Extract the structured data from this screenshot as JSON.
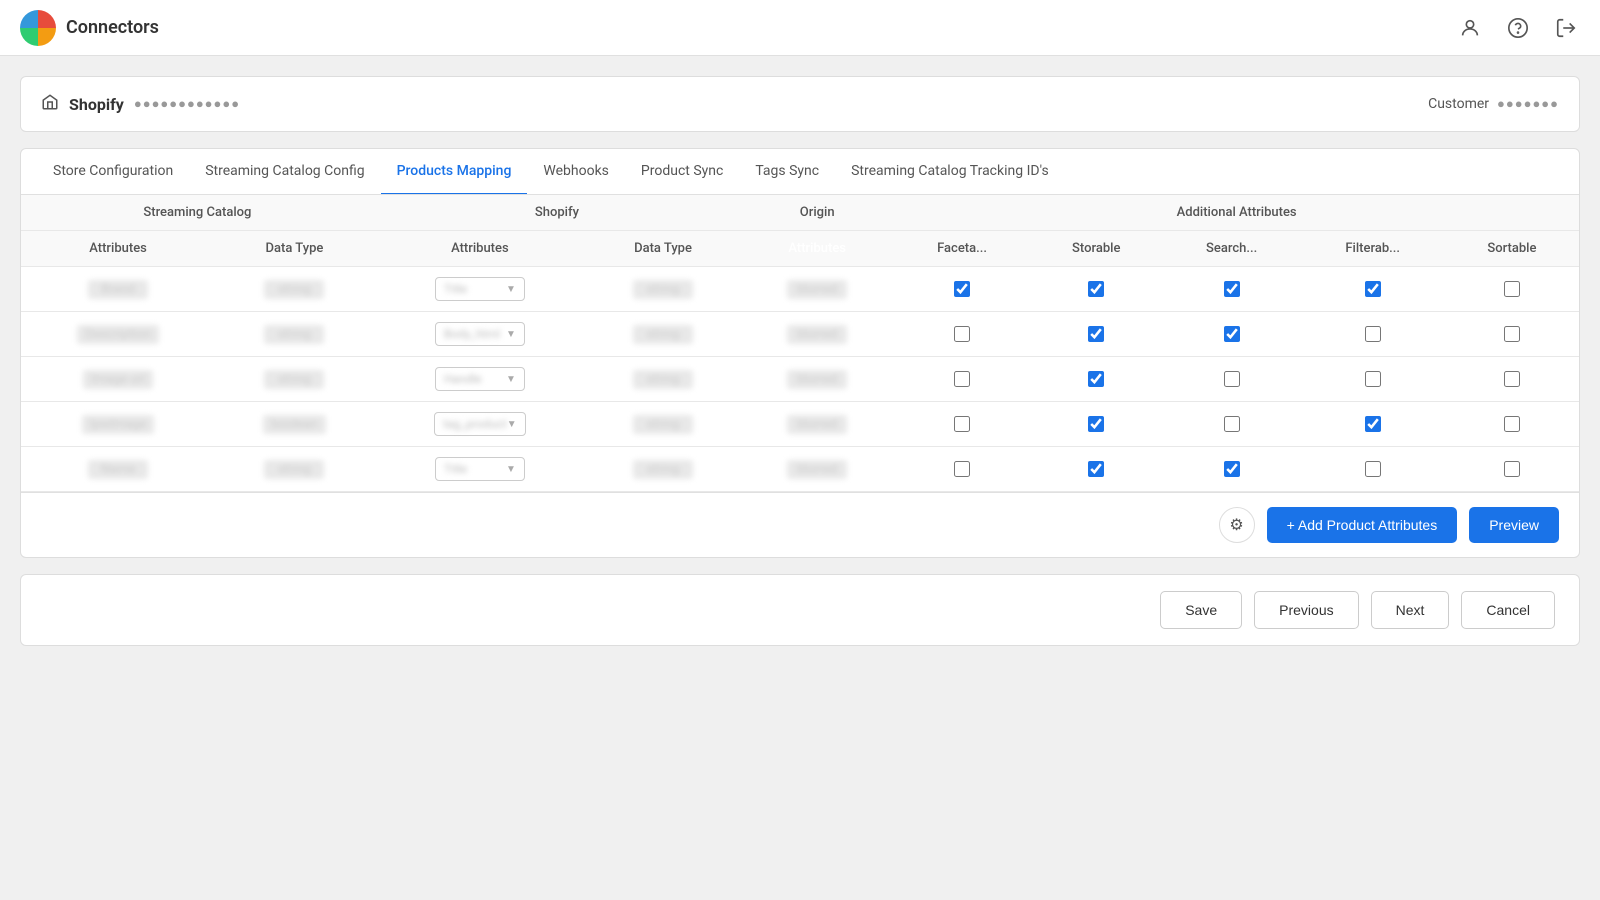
{
  "header": {
    "app_title": "Connectors",
    "logo_emoji": "🏠",
    "icons": [
      "person",
      "help",
      "logout"
    ]
  },
  "shopify_bar": {
    "home_icon": "🏠",
    "title": "Shopify",
    "subtitle": "●●●●●●●●●●●●",
    "customer_label": "Customer",
    "customer_value": "●●●●●●●"
  },
  "tabs": [
    {
      "label": "Store Configuration",
      "active": false
    },
    {
      "label": "Streaming Catalog Config",
      "active": false
    },
    {
      "label": "Products Mapping",
      "active": true
    },
    {
      "label": "Webhooks",
      "active": false
    },
    {
      "label": "Product Sync",
      "active": false
    },
    {
      "label": "Tags Sync",
      "active": false
    },
    {
      "label": "Streaming Catalog Tracking ID's",
      "active": false
    }
  ],
  "table": {
    "streaming_catalog_header": "Streaming Catalog",
    "shopify_header": "Shopify",
    "additional_attributes_header": "Additional Attributes",
    "origin_header": "Origin",
    "col_headers": {
      "sc_attributes": "Attributes",
      "sc_data_type": "Data Type",
      "sh_attributes": "Attributes",
      "sh_data_type": "Data Type",
      "facetable": "Faceta...",
      "storable": "Storable",
      "searchable": "Search...",
      "filterable": "Filterab...",
      "sortable": "Sortable"
    },
    "rows": [
      {
        "sc_attribute": "Brand",
        "sc_data_type": "string",
        "sh_attribute": "Title",
        "sh_data_type": "string",
        "origin": "blurred",
        "facetable": true,
        "storable": true,
        "searchable": true,
        "filterable": true,
        "sortable": false
      },
      {
        "sc_attribute": "Description",
        "sc_data_type": "string",
        "sh_attribute": "Body_html",
        "sh_data_type": "string",
        "origin": "blurred",
        "facetable": false,
        "storable": true,
        "searchable": true,
        "filterable": false,
        "sortable": false
      },
      {
        "sc_attribute": "Image url",
        "sc_data_type": "string",
        "sh_attribute": "Handle",
        "sh_data_type": "string",
        "origin": "blurred",
        "facetable": false,
        "storable": true,
        "searchable": false,
        "filterable": false,
        "sortable": false
      },
      {
        "sc_attribute": "IpwImage",
        "sc_data_type": "boolean",
        "sh_attribute": "tag_product",
        "sh_data_type": "string",
        "origin": "blurred",
        "facetable": false,
        "storable": true,
        "searchable": false,
        "filterable": true,
        "sortable": false
      },
      {
        "sc_attribute": "Name",
        "sc_data_type": "string",
        "sh_attribute": "Title",
        "sh_data_type": "string",
        "origin": "blurred",
        "facetable": false,
        "storable": true,
        "searchable": true,
        "filterable": false,
        "sortable": false
      }
    ]
  },
  "action_bar": {
    "add_attributes_label": "+ Add Product Attributes",
    "preview_label": "Preview",
    "gear_icon": "⚙"
  },
  "footer": {
    "save_label": "Save",
    "previous_label": "Previous",
    "next_label": "Next",
    "cancel_label": "Cancel"
  }
}
